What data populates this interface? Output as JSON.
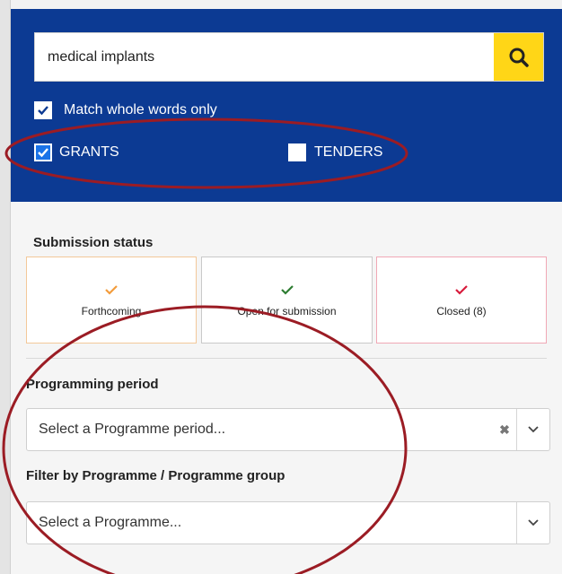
{
  "search": {
    "value": "medical implants",
    "button_icon": "search-icon"
  },
  "options": {
    "match_whole_words": {
      "label": "Match whole words only",
      "checked": true
    },
    "grants": {
      "label": "GRANTS",
      "checked": true
    },
    "tenders": {
      "label": "TENDERS",
      "checked": false
    }
  },
  "submission_status": {
    "title": "Submission status",
    "cards": [
      {
        "label": "Forthcoming",
        "check_color": "#f39c3c"
      },
      {
        "label": "Open for submission",
        "check_color": "#2e7d32"
      },
      {
        "label": "Closed (8)",
        "check_color": "#d81b3c"
      }
    ]
  },
  "programming_period": {
    "title": "Programming period",
    "placeholder": "Select a Programme period..."
  },
  "programme_filter": {
    "title": "Filter by Programme / Programme group",
    "placeholder": "Select a Programme..."
  },
  "colors": {
    "header_bg": "#0c3a93",
    "search_button": "#ffd617",
    "annotation": "#9b1c24"
  }
}
